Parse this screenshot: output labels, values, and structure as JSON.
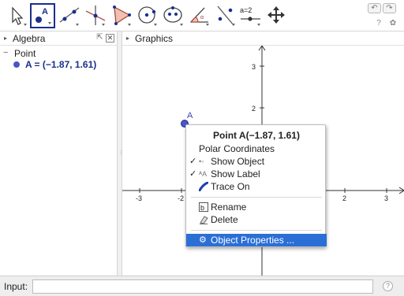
{
  "toolbar": {
    "tools": [
      {
        "name": "move-tool-icon"
      },
      {
        "name": "point-tool-icon",
        "label": "A",
        "selected": true
      },
      {
        "name": "line-tool-icon"
      },
      {
        "name": "perpendicular-line-tool-icon"
      },
      {
        "name": "polygon-tool-icon"
      },
      {
        "name": "circle-tool-icon"
      },
      {
        "name": "ellipse-tool-icon"
      },
      {
        "name": "angle-tool-icon"
      },
      {
        "name": "reflect-tool-icon"
      },
      {
        "name": "slider-tool-icon",
        "label": "a=2"
      },
      {
        "name": "move-graphics-view-tool-icon"
      }
    ],
    "undo_glyph": "↶",
    "redo_glyph": "↷",
    "help_glyph": "?",
    "settings_glyph": "✿"
  },
  "algebra": {
    "title": "Algebra",
    "group_label": "Point",
    "collapse_glyph": "−",
    "items": [
      {
        "text": "A = (−1.87, 1.61)"
      }
    ]
  },
  "graphics": {
    "title": "Graphics",
    "x_tick_labels": [
      "-3",
      "-2",
      "2",
      "3"
    ],
    "y_tick_labels": [
      "3",
      "2"
    ],
    "point_label": "A",
    "point_color": "#4a55c8"
  },
  "panel_controls": {
    "undock": "⇱",
    "close": "✕",
    "collapse_arrow": "▸"
  },
  "context_menu": {
    "title": "Point A(−1.87, 1.61)",
    "items": {
      "polar": "Polar Coordinates",
      "show_object": "Show Object",
      "show_label": "Show Label",
      "trace_on": "Trace On",
      "rename": "Rename",
      "delete": "Delete",
      "properties": "Object Properties ..."
    },
    "check_glyph": "✓",
    "highlight_color": "#2a6fd6"
  },
  "inputbar": {
    "label": "Input:",
    "value": "",
    "placeholder": "",
    "help_glyph": "?"
  }
}
